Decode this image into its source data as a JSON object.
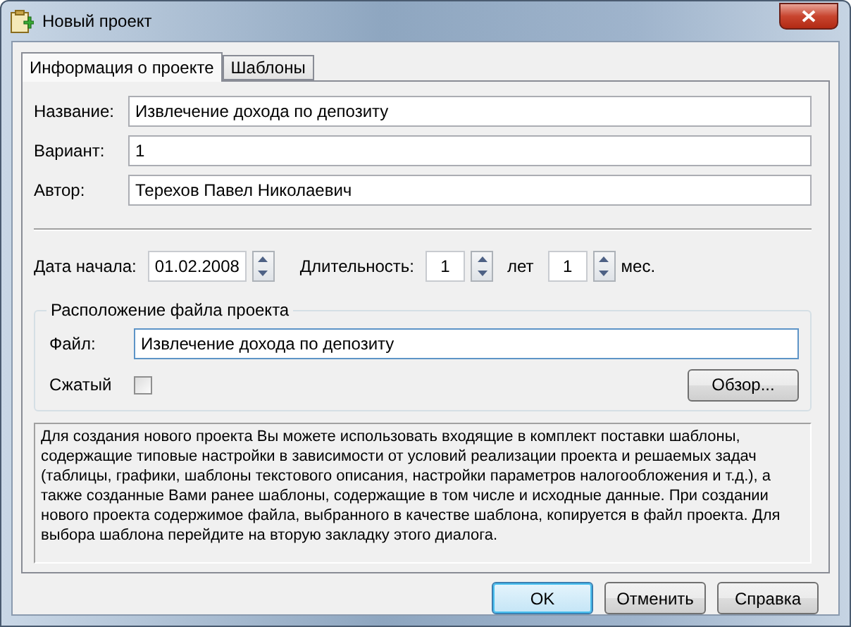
{
  "window": {
    "title": "Новый проект"
  },
  "tabs": [
    {
      "label": "Информация о проекте",
      "selected": true
    },
    {
      "label": "Шаблоны",
      "selected": false
    }
  ],
  "fields": [
    {
      "label": "Название:",
      "value": "Извлечение дохода по депозиту"
    },
    {
      "label": "Вариант:",
      "value": "1"
    },
    {
      "label": "Автор:",
      "value": "Терехов Павел Николаевич"
    }
  ],
  "start_date": {
    "label": "Дата начала:",
    "value": "01.02.2008"
  },
  "duration": {
    "label": "Длительность:",
    "years": "1",
    "years_unit": "лет",
    "months": "1",
    "months_unit": "мес."
  },
  "file_group": {
    "title": "Расположение файла проекта",
    "file_label": "Файл:",
    "file_value": "Извлечение дохода по депозиту",
    "compressed_label": "Сжатый",
    "compressed_checked": false,
    "browse_button": "Обзор..."
  },
  "description": "Для создания нового проекта Вы можете использовать входящие в комплект поставки шаблоны, содержащие типовые настройки в зависимости от условий реализации проекта и решаемых задач (таблицы, графики, шаблоны текстового описания, настройки параметров налогообложения и т.д.), а также созданные Вами ранее шаблоны, содержащие в том числе и исходные данные. При создании нового проекта содержимое файла, выбранного в качестве шаблона, копируется в файл проекта. Для выбора шаблона перейдите на вторую закладку этого диалога.",
  "buttons": [
    {
      "label": "OK",
      "default": true
    },
    {
      "label": "Отменить",
      "default": false
    },
    {
      "label": "Справка",
      "default": false
    }
  ]
}
